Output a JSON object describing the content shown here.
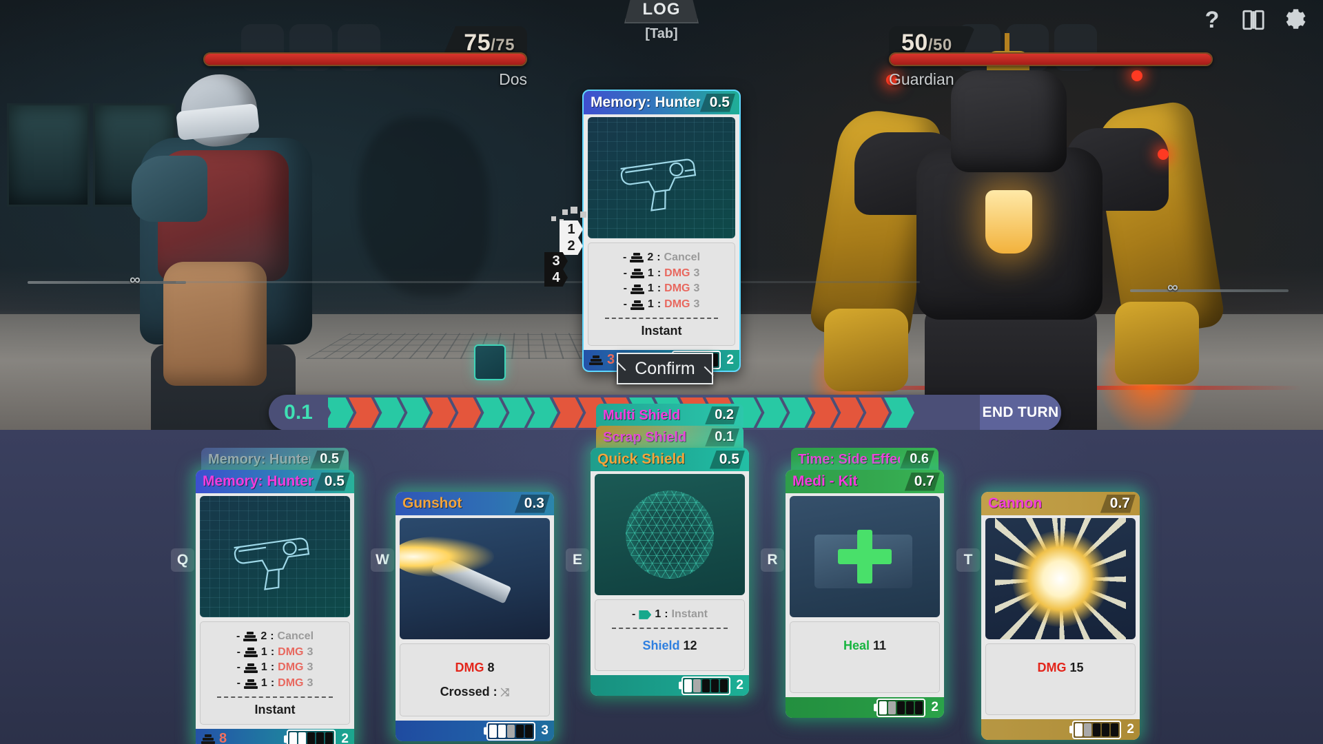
{
  "topbar": {
    "log_label": "LOG",
    "log_key": "[Tab]",
    "help_icon": "question-mark-icon",
    "deck_icon": "deck-icon",
    "settings_icon": "gear-icon"
  },
  "combatants": {
    "player": {
      "name": "Dos",
      "hp_current": 75,
      "hp_max": 75,
      "hp_text": "75",
      "hp_max_text": "/75",
      "hp_percent": 100
    },
    "enemy": {
      "name": "Guardian",
      "hp_current": 50,
      "hp_max": 50,
      "hp_text": "50",
      "hp_max_text": "/50",
      "hp_percent": 100
    }
  },
  "preview_card": {
    "name": "Memory: Hunter",
    "cost": "0.5",
    "art": "pistol-blueprint",
    "effects": [
      {
        "dash": "-",
        "icon": "cards-icon",
        "num": "2",
        "colon": ":",
        "label": "Cancel",
        "label_class": "fx-label-grey",
        "value": ""
      },
      {
        "dash": "-",
        "icon": "cards-icon",
        "num": "1",
        "colon": ":",
        "label": "DMG",
        "label_class": "fx-dmg",
        "value": "3"
      },
      {
        "dash": "-",
        "icon": "cards-icon",
        "num": "1",
        "colon": ":",
        "label": "DMG",
        "label_class": "fx-dmg",
        "value": "3"
      },
      {
        "dash": "-",
        "icon": "cards-icon",
        "num": "1",
        "colon": ":",
        "label": "DMG",
        "label_class": "fx-dmg",
        "value": "3"
      }
    ],
    "footer_note": "Instant",
    "deck_cost": "3",
    "charges_filled": 1,
    "charges_half": 1,
    "charges_total": 5,
    "copies": "2"
  },
  "order_markers": [
    {
      "value": "1",
      "state": "lit"
    },
    {
      "value": "2",
      "state": "lit"
    },
    {
      "value": "3",
      "state": "dim"
    },
    {
      "value": "4",
      "state": "dim"
    }
  ],
  "confirm_button": {
    "label": "Confirm"
  },
  "timeline": {
    "time": "0.1",
    "end_turn_label": "END TURN",
    "segments": [
      "a",
      "b",
      "a",
      "a",
      "b",
      "b",
      "a",
      "a",
      "a",
      "b",
      "b",
      "b",
      "a",
      "a",
      "b",
      "b",
      "a",
      "a",
      "a",
      "b",
      "b",
      "b",
      "a"
    ]
  },
  "hand": {
    "cards": [
      {
        "hotkey": "Q",
        "name": "Memory: Hunter",
        "cost": "0.5",
        "name_color": "#f23ddc",
        "header_bg": "linear-gradient(90deg,#3d4fd0 0%, #2f7fb8 55%, #28b29a 100%)",
        "footer_bg": "linear-gradient(90deg,#2452a8 0%, #1f7fa0 55%, #1ba88e 100%)",
        "art": "pistol-blueprint",
        "ghosts": [
          {
            "name": "Memory: Hunter",
            "cost": "0.5",
            "name_color": "#9fa6ad",
            "header_bg": "linear-gradient(90deg,#4b5a8e 0%, #4a7f9a 55%, #4a9e90 100%)"
          }
        ],
        "effects": [
          {
            "dash": "-",
            "icon": "cards-icon",
            "num": "2",
            "colon": ":",
            "label": "Cancel",
            "label_class": "fx-label-grey",
            "value": ""
          },
          {
            "dash": "-",
            "icon": "cards-icon",
            "num": "1",
            "colon": ":",
            "label": "DMG",
            "label_class": "fx-dmg",
            "value": "3"
          },
          {
            "dash": "-",
            "icon": "cards-icon",
            "num": "1",
            "colon": ":",
            "label": "DMG",
            "label_class": "fx-dmg",
            "value": "3"
          },
          {
            "dash": "-",
            "icon": "cards-icon",
            "num": "1",
            "colon": ":",
            "label": "DMG",
            "label_class": "fx-dmg",
            "value": "3"
          }
        ],
        "footer_note": "Instant",
        "deck_cost": "8",
        "charges_filled": 2,
        "charges_half": 0,
        "charges_total": 5,
        "copies": "2"
      },
      {
        "hotkey": "W",
        "name": "Gunshot",
        "cost": "0.3",
        "name_color": "#f2a43c",
        "header_bg": "linear-gradient(90deg,#2f57b8 0%, #2f6fb4 60%, #2b86ac 100%)",
        "footer_bg": "linear-gradient(90deg,#1f4ba0 0%, #2160a8 60%, #1f6f9e 100%)",
        "art": "gunshot",
        "ghosts": [],
        "effects": [],
        "stat_lines": [
          {
            "label": "DMG",
            "label_class": "fx-dmg-strong",
            "value": "8"
          },
          {
            "label": "Crossed :",
            "label_class": "",
            "value": "",
            "icon": "shuffle-icon"
          }
        ],
        "deck_cost": "",
        "charges_filled": 2,
        "charges_half": 1,
        "charges_total": 5,
        "copies": "3"
      },
      {
        "hotkey": "E",
        "name": "Quick Shield",
        "cost": "0.5",
        "name_color": "#f2a43c",
        "header_bg": "linear-gradient(90deg,#1f9e8c 0%, #1fae99 60%, #23bfa5 100%)",
        "footer_bg": "linear-gradient(90deg,#18907f 0%, #1aa18d 60%, #1cb096 100%)",
        "art": "shield-mesh",
        "ghosts": [
          {
            "name": "Multi Shield",
            "cost": "0.2",
            "name_color": "#f23ddc",
            "header_bg": "linear-gradient(90deg,#22a795 0%, #27b9a2 60%, #2cc7ab 100%)"
          },
          {
            "name": "Scrap Shield",
            "cost": "0.1",
            "name_color": "#f23ddc",
            "header_bg": "linear-gradient(90deg,#b98f33 0%, #7fae7a 55%, #2fc3a8 100%)"
          }
        ],
        "effects": [
          {
            "dash": "-",
            "icon": "arrow-icon",
            "num": "1",
            "colon": ":",
            "label": "Instant",
            "label_class": "fx-label-grey",
            "value": ""
          }
        ],
        "stat_lines": [
          {
            "label": "Shield",
            "label_class": "fx-shield",
            "value": "12"
          }
        ],
        "deck_cost": "",
        "charges_filled": 1,
        "charges_half": 1,
        "charges_total": 5,
        "copies": "2"
      },
      {
        "hotkey": "R",
        "name": "Medi - Kit",
        "cost": "0.7",
        "name_color": "#f23ddc",
        "header_bg": "linear-gradient(90deg,#2f9e4a 0%, #34a84f 60%, #38b455 100%)",
        "footer_bg": "linear-gradient(90deg,#238f3f 0%, #279944 60%, #2aa349 100%)",
        "art": "medi-kit",
        "ghosts": [
          {
            "name": "Time: Side Effect",
            "cost": "0.6",
            "name_color": "#f23ddc",
            "header_bg": "linear-gradient(90deg,#2f9e4a 0%, #34a84f 60%, #38b455 100%)"
          }
        ],
        "effects": [],
        "stat_lines": [
          {
            "label": "Heal",
            "label_class": "fx-heal",
            "value": "11"
          }
        ],
        "deck_cost": "",
        "charges_filled": 1,
        "charges_half": 1,
        "charges_total": 5,
        "copies": "2"
      },
      {
        "hotkey": "T",
        "name": "Cannon",
        "cost": "0.7",
        "name_color": "#f23ddc",
        "header_bg": "linear-gradient(90deg,#c2a04a 0%, #bd9a42 60%, #b8933a 100%)",
        "footer_bg": "linear-gradient(90deg,#b79743 0%, #b2913c 60%, #ad8b35 100%)",
        "art": "cannon-blast",
        "ghosts": [],
        "effects": [],
        "stat_lines": [
          {
            "label": "DMG",
            "label_class": "fx-dmg-strong",
            "value": "15"
          }
        ],
        "deck_cost": "",
        "charges_filled": 1,
        "charges_half": 1,
        "charges_total": 5,
        "copies": "2"
      }
    ]
  },
  "scene": {
    "infinity_left": "∞",
    "infinity_right": "∞"
  },
  "colors": {
    "teal": "#28c9a4",
    "red": "#e4563c",
    "magenta": "#f23ddc",
    "orange": "#f2a43c",
    "hp_red": "#d8352c",
    "glow": "#40e2aa"
  }
}
